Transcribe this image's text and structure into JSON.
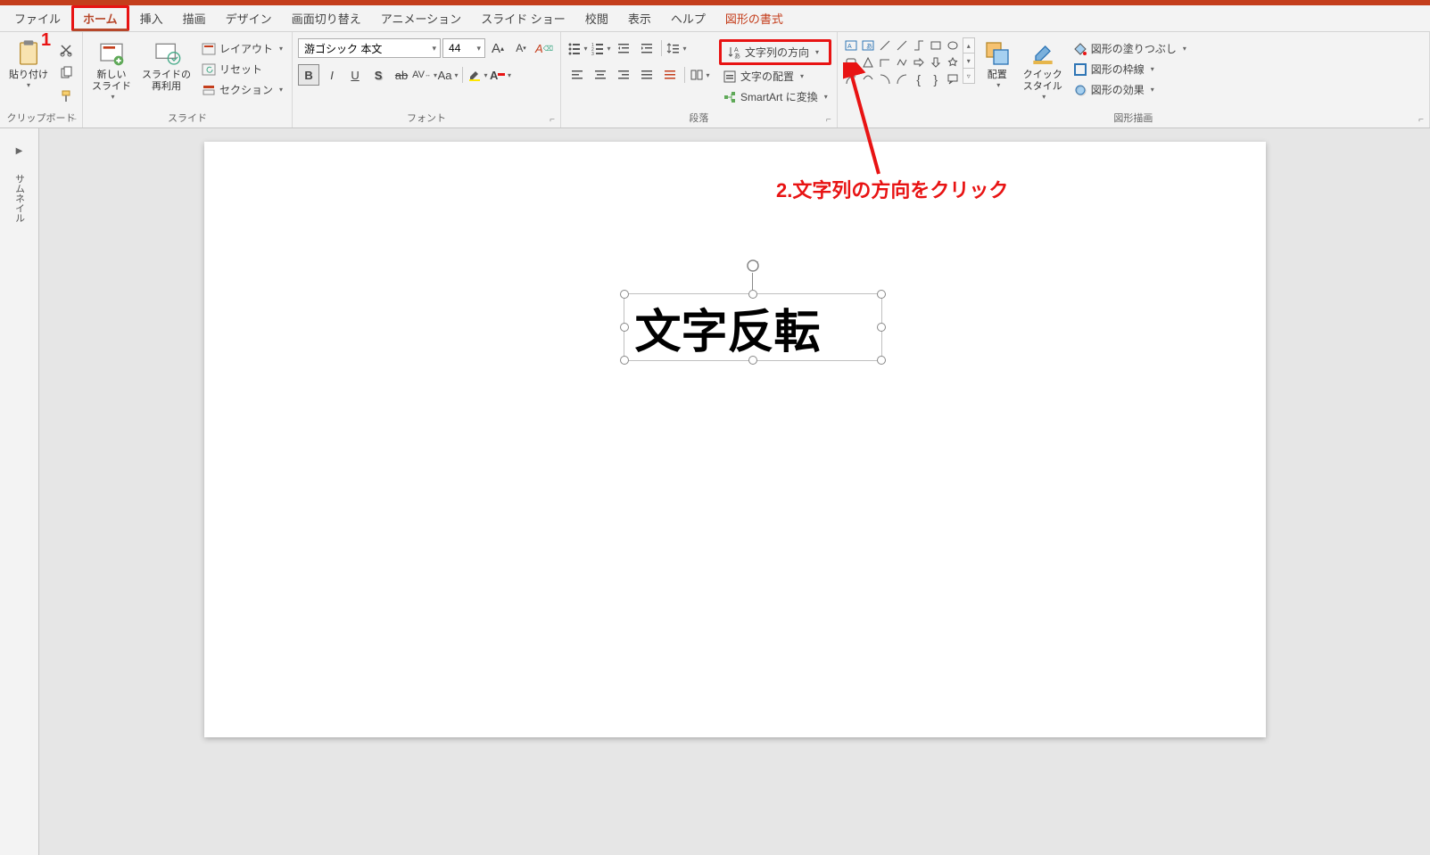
{
  "tabs": {
    "file": "ファイル",
    "home": "ホーム",
    "insert": "挿入",
    "draw": "描画",
    "design": "デザイン",
    "transitions": "画面切り替え",
    "animations": "アニメーション",
    "slideshow": "スライド ショー",
    "review": "校閲",
    "view": "表示",
    "help": "ヘルプ",
    "format": "図形の書式"
  },
  "clipboard": {
    "paste": "貼り付け",
    "group_label": "クリップボード"
  },
  "slides": {
    "new_slide": "新しい\nスライド",
    "reuse": "スライドの\n再利用",
    "layout": "レイアウト",
    "reset": "リセット",
    "section": "セクション",
    "group_label": "スライド"
  },
  "font": {
    "name": "游ゴシック 本文",
    "size": "44",
    "bold": "B",
    "italic": "I",
    "underline": "U",
    "shadow": "S",
    "strike": "ab",
    "spacing": "AV",
    "case": "Aa",
    "group_label": "フォント"
  },
  "paragraph": {
    "text_direction": "文字列の方向",
    "align_text": "文字の配置",
    "smartart": "SmartArt に変換",
    "group_label": "段落"
  },
  "drawing": {
    "arrange": "配置",
    "quick_styles": "クイック\nスタイル",
    "fill": "図形の塗りつぶし",
    "outline": "図形の枠線",
    "effects": "図形の効果",
    "group_label": "図形描画"
  },
  "thumbnail_label": "サムネイル",
  "slide_text": "文字反転",
  "annotations": {
    "num1": "1",
    "instruction2": "2.文字列の方向をクリック"
  }
}
